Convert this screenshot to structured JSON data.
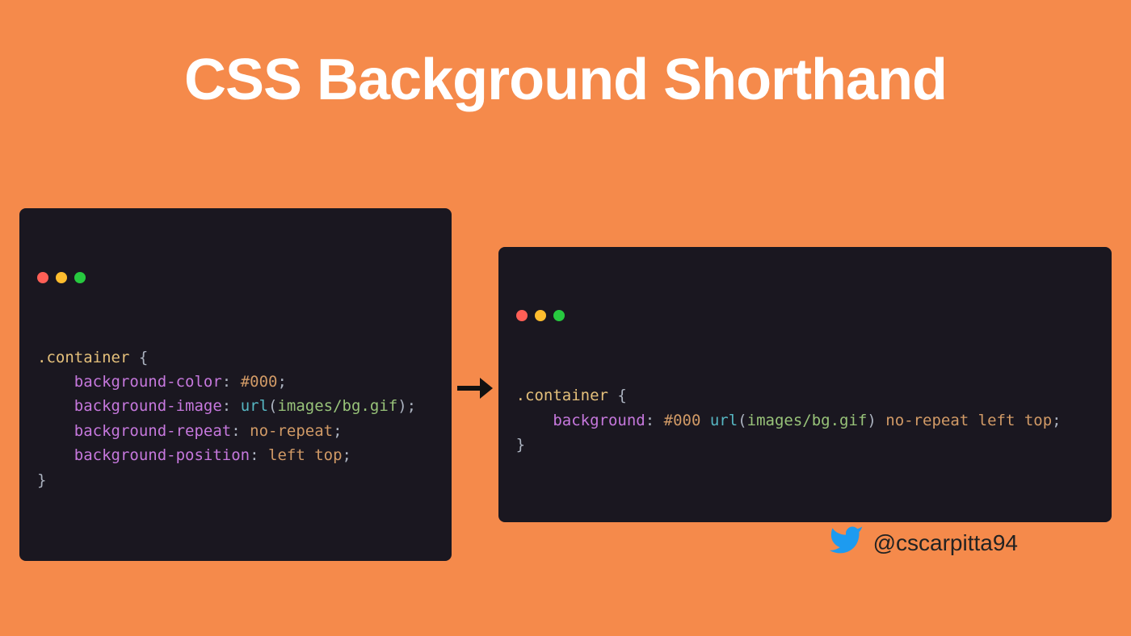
{
  "title": "CSS Background Shorthand",
  "left_code": {
    "selector": ".container",
    "open": " {",
    "lines": [
      {
        "prop": "background-color",
        "val_html": "<span class='val'>#000</span>"
      },
      {
        "prop": "background-image",
        "val_html": "<span class='func'>url</span><span class='punct'>(</span><span class='str'>images/bg.gif</span><span class='punct'>)</span>"
      },
      {
        "prop": "background-repeat",
        "val_html": "<span class='val'>no-repeat</span>"
      },
      {
        "prop": "background-position",
        "val_html": "<span class='val'>left top</span>"
      }
    ],
    "close": "}"
  },
  "right_code": {
    "selector": ".container",
    "open": " {",
    "line": {
      "prop": "background",
      "val_html": "<span class='val'>#000</span> <span class='func'>url</span><span class='punct'>(</span><span class='str'>images/bg.gif</span><span class='punct'>)</span> <span class='val'>no-repeat left top</span>"
    },
    "close": "}"
  },
  "credit": "@cscarpitta94"
}
